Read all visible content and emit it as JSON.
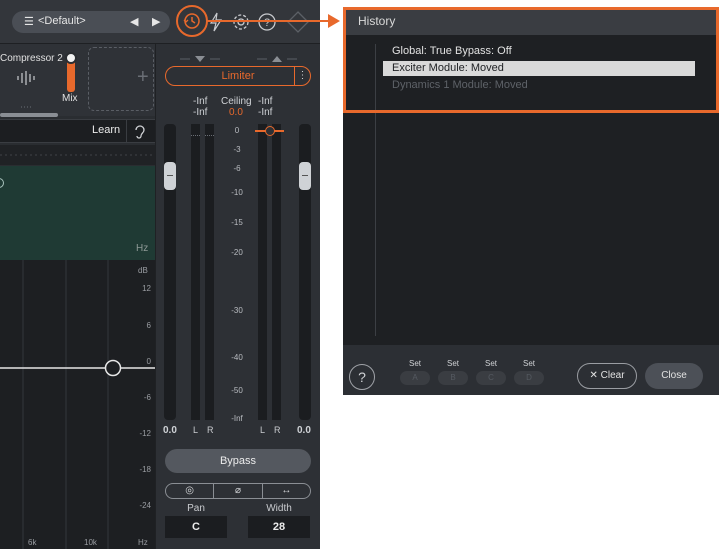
{
  "toolbar": {
    "preset_label": "<Default>",
    "menu_glyph": "☰",
    "prev_glyph": "◀",
    "next_glyph": "▶"
  },
  "module": {
    "name": "Compressor 2",
    "mix_label": "Mix"
  },
  "learn": {
    "label": "Learn"
  },
  "spectrum": {
    "hz_label": "Hz"
  },
  "eq": {
    "db_label": "dB",
    "db_ticks": [
      "12",
      "6",
      "0",
      "-6",
      "-12",
      "-18",
      "-24"
    ],
    "freq_ticks": [
      "6k",
      "10k",
      "Hz"
    ]
  },
  "limiter": {
    "mode_label": "Limiter",
    "in_left": "-Inf",
    "in_right": "-Inf",
    "ceiling_label": "Ceiling",
    "ceiling_value": "0.0",
    "out_left": "-Inf",
    "out_right": "-Inf",
    "scale": [
      "0",
      "-3",
      "-6",
      "-10",
      "-15",
      "-20",
      "-30",
      "-40",
      "-50",
      "-Inf"
    ],
    "input_gain": "0.0",
    "output_gain": "0.0",
    "ch_left": "L",
    "ch_right": "R",
    "bypass_label": "Bypass",
    "pan_label": "Pan",
    "pan_value": "C",
    "width_label": "Width",
    "width_value": "28"
  },
  "history": {
    "title": "History",
    "items": [
      {
        "label": "Global: True Bypass: Off"
      },
      {
        "label": "Exciter Module: Moved"
      },
      {
        "label": "Dynamics 1 Module: Moved"
      }
    ],
    "set_label": "Set",
    "slots": [
      "A",
      "B",
      "C",
      "D"
    ],
    "help_glyph": "?",
    "clear_label": "Clear",
    "close_label": "Close"
  },
  "colors": {
    "accent": "#e8692c",
    "selected_row": "#d9d9d9"
  }
}
